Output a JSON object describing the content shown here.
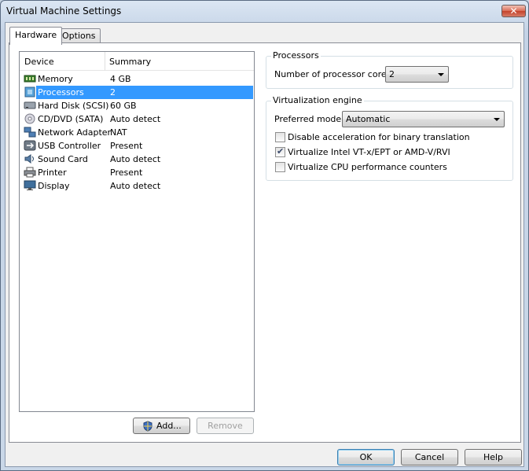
{
  "window": {
    "title": "Virtual Machine Settings",
    "close_glyph": "✕"
  },
  "tabs": [
    {
      "label": "Hardware",
      "active": true
    },
    {
      "label": "Options",
      "active": false
    }
  ],
  "devices": {
    "headers": {
      "device": "Device",
      "summary": "Summary"
    },
    "rows": [
      {
        "icon": "memory-icon",
        "name": "Memory",
        "summary": "4 GB"
      },
      {
        "icon": "processor-icon",
        "name": "Processors",
        "summary": "2",
        "selected": true
      },
      {
        "icon": "hard-disk-icon",
        "name": "Hard Disk (SCSI)",
        "summary": "60 GB"
      },
      {
        "icon": "cd-dvd-icon",
        "name": "CD/DVD (SATA)",
        "summary": "Auto detect"
      },
      {
        "icon": "network-adapter-icon",
        "name": "Network Adapter",
        "summary": "NAT"
      },
      {
        "icon": "usb-controller-icon",
        "name": "USB Controller",
        "summary": "Present"
      },
      {
        "icon": "sound-card-icon",
        "name": "Sound Card",
        "summary": "Auto detect"
      },
      {
        "icon": "printer-icon",
        "name": "Printer",
        "summary": "Present"
      },
      {
        "icon": "display-icon",
        "name": "Display",
        "summary": "Auto detect"
      }
    ],
    "add_label": "Add...",
    "remove_label": "Remove"
  },
  "processors": {
    "group_title": "Processors",
    "cores_label": "Number of processor cores:",
    "cores_value": "2"
  },
  "virtualization": {
    "group_title": "Virtualization engine",
    "mode_label": "Preferred mode:",
    "mode_value": "Automatic",
    "options": [
      {
        "label": "Disable acceleration for binary translation",
        "checked": false
      },
      {
        "label": "Virtualize Intel VT-x/EPT or AMD-V/RVI",
        "checked": true
      },
      {
        "label": "Virtualize CPU performance counters",
        "checked": false
      }
    ]
  },
  "footer": {
    "ok_label": "OK",
    "cancel_label": "Cancel",
    "help_label": "Help"
  },
  "colors": {
    "selection": "#3399ff",
    "titlebar": "#c4d3e6",
    "close": "#c4432b"
  }
}
